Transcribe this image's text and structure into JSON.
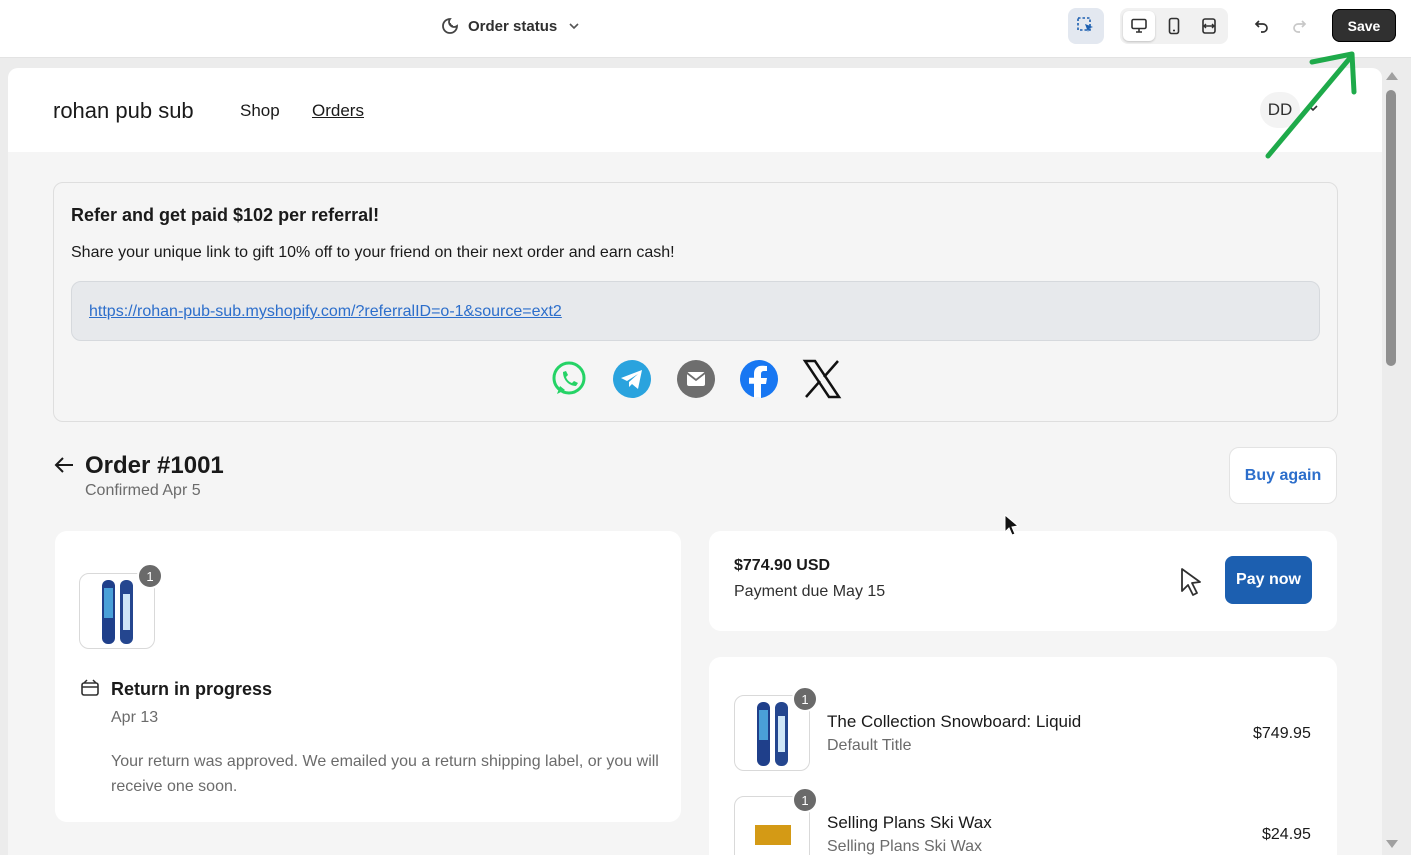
{
  "toolbar": {
    "page_title": "Order status",
    "save_label": "Save"
  },
  "store": {
    "name": "rohan pub sub",
    "nav": {
      "shop": "Shop",
      "orders": "Orders"
    },
    "avatar_initials": "DD"
  },
  "referral": {
    "title": "Refer and get paid $102 per referral!",
    "description": "Share your unique link to gift 10% off to your friend on their next order and earn cash!",
    "link": "https://rohan-pub-sub.myshopify.com/?referralID=o-1&source=ext2",
    "share_icons": [
      "whatsapp-icon",
      "telegram-icon",
      "email-icon",
      "facebook-icon",
      "x-icon"
    ]
  },
  "order": {
    "title": "Order #1001",
    "confirmed": "Confirmed Apr 5",
    "buy_again_label": "Buy again"
  },
  "return_status": {
    "item_count": "1",
    "title": "Return in progress",
    "date": "Apr 13",
    "message": "Your return was approved. We emailed you a return shipping label, or you will receive one soon."
  },
  "payment": {
    "amount": "$774.90 USD",
    "due": "Payment due May 15",
    "pay_label": "Pay now",
    "accent": "#1c5fb0"
  },
  "line_items": [
    {
      "quantity": "1",
      "title": "The Collection Snowboard: Liquid",
      "variant": "Default Title",
      "price": "$749.95"
    },
    {
      "quantity": "1",
      "title": "Selling Plans Ski Wax",
      "variant": "Selling Plans Ski Wax",
      "price": "$24.95"
    }
  ],
  "colors": {
    "link": "#2c6ecb",
    "annotation_arrow": "#1eaa4a"
  }
}
